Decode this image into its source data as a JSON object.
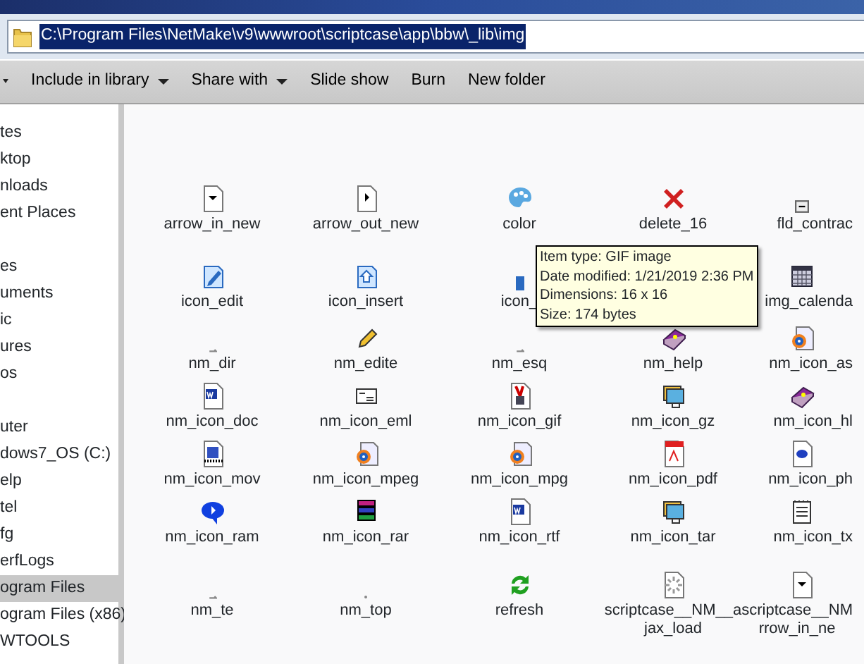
{
  "address_bar": {
    "path": "C:\\Program Files\\NetMake\\v9\\wwwroot\\scriptcase\\app\\bbw\\_lib\\img"
  },
  "toolbar": [
    {
      "label": "Include in library",
      "dropdown": true
    },
    {
      "label": "Share with",
      "dropdown": true
    },
    {
      "label": "Slide show",
      "dropdown": false
    },
    {
      "label": "Burn",
      "dropdown": false
    },
    {
      "label": "New folder",
      "dropdown": false
    }
  ],
  "sidebar": {
    "groups": [
      {
        "items": [
          {
            "label": "tes",
            "selected": false
          },
          {
            "label": "ktop",
            "selected": false
          },
          {
            "label": "nloads",
            "selected": false
          },
          {
            "label": "ent Places",
            "selected": false
          }
        ]
      },
      {
        "items": [
          {
            "label": "es",
            "selected": false
          },
          {
            "label": "uments",
            "selected": false
          },
          {
            "label": "ic",
            "selected": false
          },
          {
            "label": "ures",
            "selected": false
          },
          {
            "label": "os",
            "selected": false
          }
        ]
      },
      {
        "items": [
          {
            "label": "uter",
            "selected": false
          },
          {
            "label": "dows7_OS (C:)",
            "selected": false
          },
          {
            "label": "elp",
            "selected": false
          },
          {
            "label": "tel",
            "selected": false
          },
          {
            "label": "fg",
            "selected": false
          },
          {
            "label": "erfLogs",
            "selected": false
          },
          {
            "label": "ogram Files",
            "selected": true
          },
          {
            "label": "ogram Files (x86)",
            "selected": false
          },
          {
            "label": "WTOOLS",
            "selected": false
          }
        ]
      }
    ]
  },
  "files": [
    {
      "label": "arrow_in_new"
    },
    {
      "label": "arrow_out_new"
    },
    {
      "label": "color"
    },
    {
      "label": "delete_16"
    },
    {
      "label": "fld_contrac"
    },
    {
      "label": "icon_edit"
    },
    {
      "label": "icon_insert"
    },
    {
      "label": "icon_"
    },
    {
      "label": "img_calenda"
    },
    {
      "label": "nm_dir"
    },
    {
      "label": "nm_edite"
    },
    {
      "label": "nm_esq"
    },
    {
      "label": "nm_help"
    },
    {
      "label": "nm_icon_as"
    },
    {
      "label": "nm_icon_doc"
    },
    {
      "label": "nm_icon_eml"
    },
    {
      "label": "nm_icon_gif"
    },
    {
      "label": "nm_icon_gz"
    },
    {
      "label": "nm_icon_hl"
    },
    {
      "label": "nm_icon_mov"
    },
    {
      "label": "nm_icon_mpeg"
    },
    {
      "label": "nm_icon_mpg"
    },
    {
      "label": "nm_icon_pdf"
    },
    {
      "label": "nm_icon_ph"
    },
    {
      "label": "nm_icon_ram"
    },
    {
      "label": "nm_icon_rar"
    },
    {
      "label": "nm_icon_rtf"
    },
    {
      "label": "nm_icon_tar"
    },
    {
      "label": "nm_icon_tx"
    },
    {
      "label": "nm_te"
    },
    {
      "label": "nm_top"
    },
    {
      "label": "refresh"
    },
    {
      "label": "scriptcase__NM__a\njax_load"
    },
    {
      "label": "scriptcase__NM\nrrow_in_ne"
    }
  ],
  "tooltip": {
    "lines": [
      "Item type: GIF image",
      "Date modified: 1/21/2019 2:36 PM",
      "Dimensions: 16 x 16",
      "Size: 174 bytes"
    ]
  }
}
